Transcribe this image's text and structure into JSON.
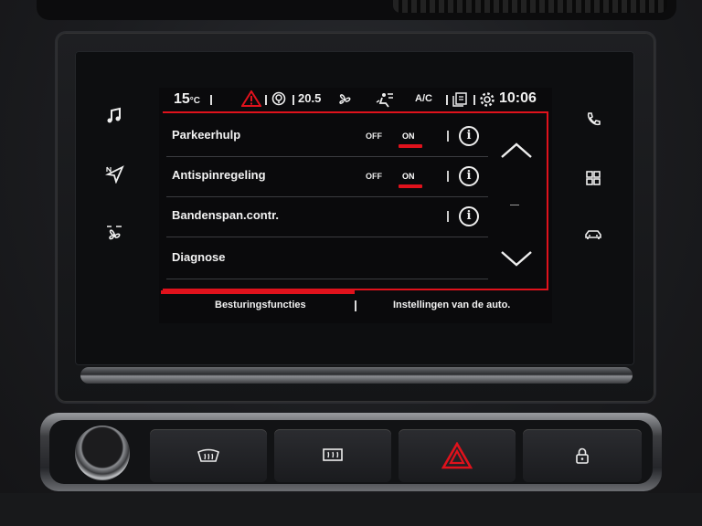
{
  "statusbar": {
    "temperature": "15",
    "temperature_unit": "°C",
    "climate_setpoint": "20.5",
    "ac_label": "A/C",
    "clock": "10:06"
  },
  "settings_list": {
    "items": [
      {
        "label": "Parkeerhulp",
        "toggle_off": "OFF",
        "toggle_on": "ON",
        "state": "ON",
        "has_info": true
      },
      {
        "label": "Antispinregeling",
        "toggle_off": "OFF",
        "toggle_on": "ON",
        "state": "ON",
        "has_info": true
      },
      {
        "label": "Bandenspan.contr.",
        "has_info": true
      },
      {
        "label": "Diagnose"
      }
    ],
    "info_glyph": "i",
    "dash": "–"
  },
  "tabs": [
    {
      "label": "Besturingsfuncties",
      "active": true
    },
    {
      "label": "Instellingen van de auto.",
      "active": false
    }
  ],
  "colors": {
    "accent": "#e0121c",
    "text": "#f2f2f2",
    "screen_bg": "#0a0a0c"
  },
  "icons": {
    "left_bar": [
      "music-icon",
      "navigation-icon",
      "fan-icon"
    ],
    "right_bar": [
      "phone-icon",
      "apps-grid-icon",
      "car-icon"
    ],
    "status": [
      "warning-icon",
      "location-icon",
      "fan-icon",
      "air-flow-icon",
      "mirror-icon",
      "settings-gear-icon"
    ],
    "console": [
      "rear-defrost-icon",
      "front-defrost-icon",
      "hazard-icon",
      "lock-icon"
    ]
  }
}
